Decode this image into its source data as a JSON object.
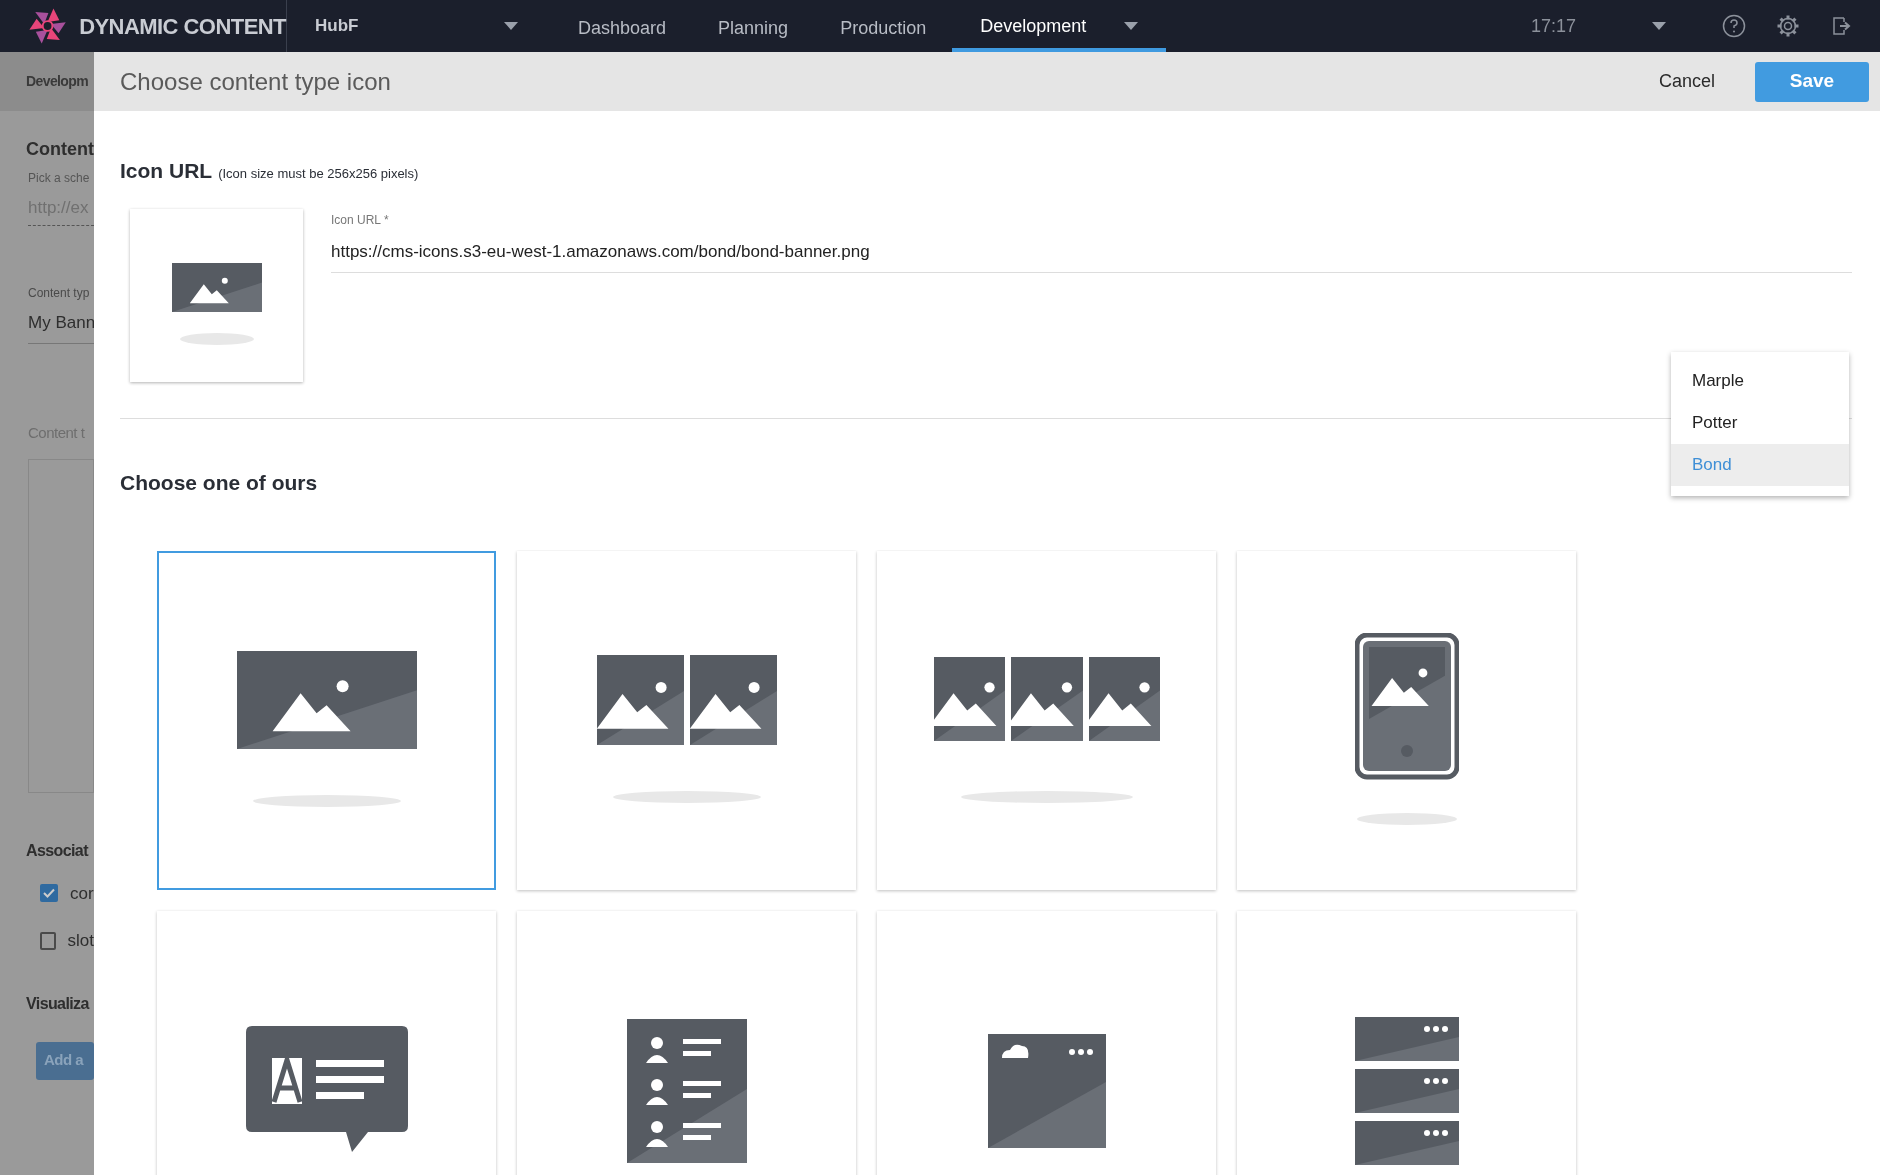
{
  "app": {
    "title": "DYNAMIC CONTENT",
    "hub": "HubF",
    "time": "17:17"
  },
  "nav_tabs": [
    {
      "label": "Dashboard",
      "selected": false
    },
    {
      "label": "Planning",
      "selected": false
    },
    {
      "label": "Production",
      "selected": false
    },
    {
      "label": "Development",
      "selected": true
    }
  ],
  "background_page": {
    "breadcrumb": "Developm",
    "section_title": "Content",
    "hint": "Pick a sche",
    "placeholder": "http://ex",
    "type_label": "Content typ",
    "type_value": "My Bann",
    "content_label": "Content t",
    "assoc_title": "Associat",
    "checkboxes": [
      {
        "label": "cor",
        "checked": true
      },
      {
        "label": "slot",
        "checked": false
      }
    ],
    "vis_title": "Visualiza",
    "button": "Add a"
  },
  "panel": {
    "title": "Choose content type icon",
    "cancel": "Cancel",
    "save": "Save"
  },
  "icon_url": {
    "heading": "Icon URL",
    "note": "(Icon size must be 256x256 pixels)",
    "field_label": "Icon URL *",
    "value": "https://cms-icons.s3-eu-west-1.amazonaws.com/bond/bond-banner.png"
  },
  "menu": [
    {
      "label": "Marple",
      "selected": false
    },
    {
      "label": "Potter",
      "selected": false
    },
    {
      "label": "Bond",
      "selected": true
    }
  ],
  "gallery": {
    "heading": "Choose one of ours",
    "icons": [
      {
        "kind": "banner",
        "selected": true
      },
      {
        "kind": "banner2",
        "selected": false
      },
      {
        "kind": "banner3",
        "selected": false
      },
      {
        "kind": "tablet",
        "selected": false
      },
      {
        "kind": "bubble",
        "selected": false
      },
      {
        "kind": "list",
        "selected": false
      },
      {
        "kind": "card",
        "selected": false
      },
      {
        "kind": "stack",
        "selected": false
      }
    ]
  }
}
